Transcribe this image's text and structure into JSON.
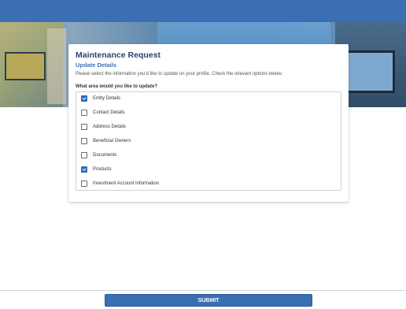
{
  "header": {
    "bar_color": "#3a6fb3"
  },
  "card": {
    "title": "Maintenance Request",
    "subtitle": "Update Details",
    "description": "Please select the information you'd like to update on your profile. Check the relevant options below:",
    "question": "What area would you like to update?",
    "options": [
      {
        "label": "Entity Details",
        "checked": true
      },
      {
        "label": "Contact Details",
        "checked": false
      },
      {
        "label": "Address Details",
        "checked": false
      },
      {
        "label": "Beneficial Owners",
        "checked": false
      },
      {
        "label": "Documents",
        "checked": false
      },
      {
        "label": "Products",
        "checked": true
      },
      {
        "label": "Investment Account Information",
        "checked": false
      }
    ]
  },
  "footer": {
    "submit_label": "SUBMIT"
  },
  "colors": {
    "accent": "#3a6fb3",
    "title": "#28466f",
    "subtitle": "#3d73b8"
  }
}
